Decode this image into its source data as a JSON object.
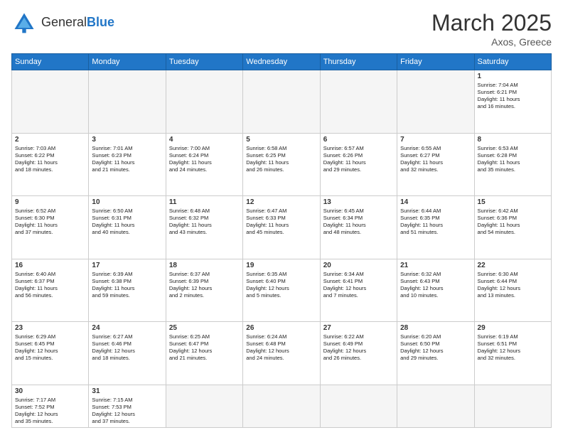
{
  "header": {
    "logo_general": "General",
    "logo_blue": "Blue",
    "month": "March 2025",
    "location": "Axos, Greece"
  },
  "weekdays": [
    "Sunday",
    "Monday",
    "Tuesday",
    "Wednesday",
    "Thursday",
    "Friday",
    "Saturday"
  ],
  "weeks": [
    [
      {
        "day": "",
        "info": ""
      },
      {
        "day": "",
        "info": ""
      },
      {
        "day": "",
        "info": ""
      },
      {
        "day": "",
        "info": ""
      },
      {
        "day": "",
        "info": ""
      },
      {
        "day": "",
        "info": ""
      },
      {
        "day": "1",
        "info": "Sunrise: 7:04 AM\nSunset: 6:21 PM\nDaylight: 11 hours\nand 16 minutes."
      }
    ],
    [
      {
        "day": "2",
        "info": "Sunrise: 7:03 AM\nSunset: 6:22 PM\nDaylight: 11 hours\nand 18 minutes."
      },
      {
        "day": "3",
        "info": "Sunrise: 7:01 AM\nSunset: 6:23 PM\nDaylight: 11 hours\nand 21 minutes."
      },
      {
        "day": "4",
        "info": "Sunrise: 7:00 AM\nSunset: 6:24 PM\nDaylight: 11 hours\nand 24 minutes."
      },
      {
        "day": "5",
        "info": "Sunrise: 6:58 AM\nSunset: 6:25 PM\nDaylight: 11 hours\nand 26 minutes."
      },
      {
        "day": "6",
        "info": "Sunrise: 6:57 AM\nSunset: 6:26 PM\nDaylight: 11 hours\nand 29 minutes."
      },
      {
        "day": "7",
        "info": "Sunrise: 6:55 AM\nSunset: 6:27 PM\nDaylight: 11 hours\nand 32 minutes."
      },
      {
        "day": "8",
        "info": "Sunrise: 6:53 AM\nSunset: 6:28 PM\nDaylight: 11 hours\nand 35 minutes."
      }
    ],
    [
      {
        "day": "9",
        "info": "Sunrise: 6:52 AM\nSunset: 6:30 PM\nDaylight: 11 hours\nand 37 minutes."
      },
      {
        "day": "10",
        "info": "Sunrise: 6:50 AM\nSunset: 6:31 PM\nDaylight: 11 hours\nand 40 minutes."
      },
      {
        "day": "11",
        "info": "Sunrise: 6:48 AM\nSunset: 6:32 PM\nDaylight: 11 hours\nand 43 minutes."
      },
      {
        "day": "12",
        "info": "Sunrise: 6:47 AM\nSunset: 6:33 PM\nDaylight: 11 hours\nand 45 minutes."
      },
      {
        "day": "13",
        "info": "Sunrise: 6:45 AM\nSunset: 6:34 PM\nDaylight: 11 hours\nand 48 minutes."
      },
      {
        "day": "14",
        "info": "Sunrise: 6:44 AM\nSunset: 6:35 PM\nDaylight: 11 hours\nand 51 minutes."
      },
      {
        "day": "15",
        "info": "Sunrise: 6:42 AM\nSunset: 6:36 PM\nDaylight: 11 hours\nand 54 minutes."
      }
    ],
    [
      {
        "day": "16",
        "info": "Sunrise: 6:40 AM\nSunset: 6:37 PM\nDaylight: 11 hours\nand 56 minutes."
      },
      {
        "day": "17",
        "info": "Sunrise: 6:39 AM\nSunset: 6:38 PM\nDaylight: 11 hours\nand 59 minutes."
      },
      {
        "day": "18",
        "info": "Sunrise: 6:37 AM\nSunset: 6:39 PM\nDaylight: 12 hours\nand 2 minutes."
      },
      {
        "day": "19",
        "info": "Sunrise: 6:35 AM\nSunset: 6:40 PM\nDaylight: 12 hours\nand 5 minutes."
      },
      {
        "day": "20",
        "info": "Sunrise: 6:34 AM\nSunset: 6:41 PM\nDaylight: 12 hours\nand 7 minutes."
      },
      {
        "day": "21",
        "info": "Sunrise: 6:32 AM\nSunset: 6:43 PM\nDaylight: 12 hours\nand 10 minutes."
      },
      {
        "day": "22",
        "info": "Sunrise: 6:30 AM\nSunset: 6:44 PM\nDaylight: 12 hours\nand 13 minutes."
      }
    ],
    [
      {
        "day": "23",
        "info": "Sunrise: 6:29 AM\nSunset: 6:45 PM\nDaylight: 12 hours\nand 15 minutes."
      },
      {
        "day": "24",
        "info": "Sunrise: 6:27 AM\nSunset: 6:46 PM\nDaylight: 12 hours\nand 18 minutes."
      },
      {
        "day": "25",
        "info": "Sunrise: 6:25 AM\nSunset: 6:47 PM\nDaylight: 12 hours\nand 21 minutes."
      },
      {
        "day": "26",
        "info": "Sunrise: 6:24 AM\nSunset: 6:48 PM\nDaylight: 12 hours\nand 24 minutes."
      },
      {
        "day": "27",
        "info": "Sunrise: 6:22 AM\nSunset: 6:49 PM\nDaylight: 12 hours\nand 26 minutes."
      },
      {
        "day": "28",
        "info": "Sunrise: 6:20 AM\nSunset: 6:50 PM\nDaylight: 12 hours\nand 29 minutes."
      },
      {
        "day": "29",
        "info": "Sunrise: 6:19 AM\nSunset: 6:51 PM\nDaylight: 12 hours\nand 32 minutes."
      }
    ],
    [
      {
        "day": "30",
        "info": "Sunrise: 7:17 AM\nSunset: 7:52 PM\nDaylight: 12 hours\nand 35 minutes."
      },
      {
        "day": "31",
        "info": "Sunrise: 7:15 AM\nSunset: 7:53 PM\nDaylight: 12 hours\nand 37 minutes."
      },
      {
        "day": "",
        "info": ""
      },
      {
        "day": "",
        "info": ""
      },
      {
        "day": "",
        "info": ""
      },
      {
        "day": "",
        "info": ""
      },
      {
        "day": "",
        "info": ""
      }
    ]
  ]
}
